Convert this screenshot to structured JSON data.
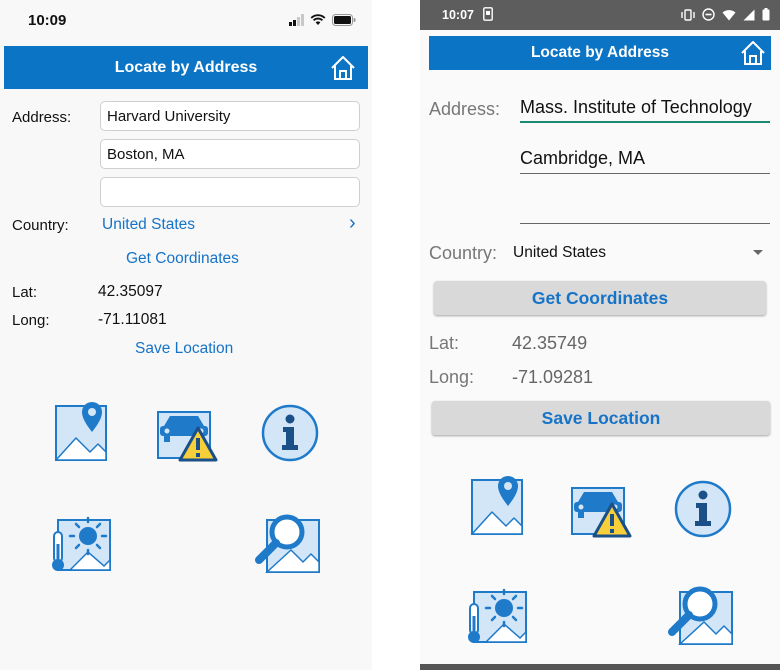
{
  "ios": {
    "status": {
      "time": "10:09"
    },
    "navbar": {
      "title": "Locate by Address"
    },
    "form": {
      "address_label": "Address:",
      "address_line1": "Harvard University",
      "address_line2": "Boston, MA",
      "address_line3": "",
      "country_label": "Country:",
      "country_value": "United States",
      "disclosure": "›",
      "get_coordinates": "Get Coordinates",
      "lat_label": "Lat:",
      "lat_value": "42.35097",
      "long_label": "Long:",
      "long_value": "-71.11081",
      "save_location": "Save Location"
    }
  },
  "android": {
    "status": {
      "time": "10:07"
    },
    "navbar": {
      "title": "Locate by Address"
    },
    "form": {
      "address_label": "Address:",
      "address_line1": "Mass. Institute of Technology",
      "address_line2": "Cambridge, MA",
      "address_line3": "",
      "country_label": "Country:",
      "country_value": "United States",
      "get_coordinates": "Get Coordinates",
      "lat_label": "Lat:",
      "lat_value": "42.35749",
      "long_label": "Long:",
      "long_value": "-71.09281",
      "save_location": "Save Location"
    }
  },
  "icons": [
    "map-pin-icon",
    "traffic-warning-icon",
    "info-icon",
    "weather-icon",
    "map-search-icon"
  ],
  "colors": {
    "accent": "#0b74c4",
    "link": "#1673c7",
    "icon_fill": "#d2e6f7",
    "icon_stroke": "#1f7ac9",
    "warning_yellow": "#f7cf3a",
    "android_statusbar": "#5d5d5d",
    "android_underline_focus": "#1b8a74"
  }
}
